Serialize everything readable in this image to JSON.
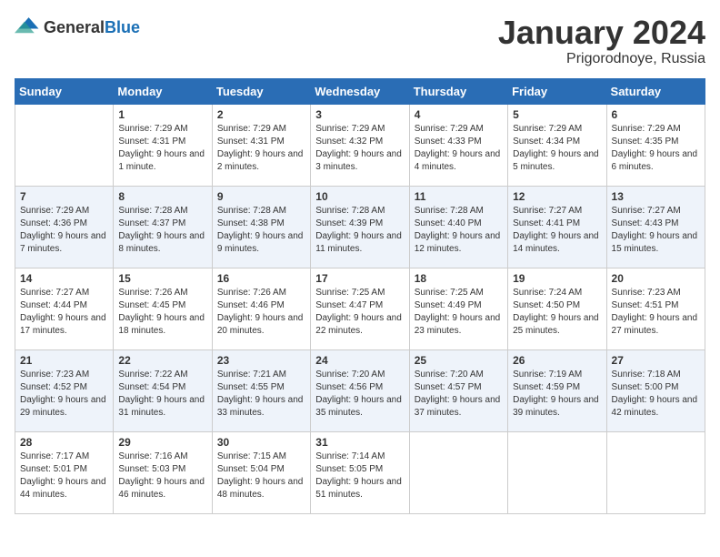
{
  "header": {
    "logo_general": "General",
    "logo_blue": "Blue",
    "title": "January 2024",
    "location": "Prigorodnoye, Russia"
  },
  "days_of_week": [
    "Sunday",
    "Monday",
    "Tuesday",
    "Wednesday",
    "Thursday",
    "Friday",
    "Saturday"
  ],
  "weeks": [
    [
      {
        "day": "",
        "sunrise": "",
        "sunset": "",
        "daylight": ""
      },
      {
        "day": "1",
        "sunrise": "7:29 AM",
        "sunset": "4:31 PM",
        "daylight": "9 hours and 1 minute."
      },
      {
        "day": "2",
        "sunrise": "7:29 AM",
        "sunset": "4:31 PM",
        "daylight": "9 hours and 2 minutes."
      },
      {
        "day": "3",
        "sunrise": "7:29 AM",
        "sunset": "4:32 PM",
        "daylight": "9 hours and 3 minutes."
      },
      {
        "day": "4",
        "sunrise": "7:29 AM",
        "sunset": "4:33 PM",
        "daylight": "9 hours and 4 minutes."
      },
      {
        "day": "5",
        "sunrise": "7:29 AM",
        "sunset": "4:34 PM",
        "daylight": "9 hours and 5 minutes."
      },
      {
        "day": "6",
        "sunrise": "7:29 AM",
        "sunset": "4:35 PM",
        "daylight": "9 hours and 6 minutes."
      }
    ],
    [
      {
        "day": "7",
        "sunrise": "7:29 AM",
        "sunset": "4:36 PM",
        "daylight": "9 hours and 7 minutes."
      },
      {
        "day": "8",
        "sunrise": "7:28 AM",
        "sunset": "4:37 PM",
        "daylight": "9 hours and 8 minutes."
      },
      {
        "day": "9",
        "sunrise": "7:28 AM",
        "sunset": "4:38 PM",
        "daylight": "9 hours and 9 minutes."
      },
      {
        "day": "10",
        "sunrise": "7:28 AM",
        "sunset": "4:39 PM",
        "daylight": "9 hours and 11 minutes."
      },
      {
        "day": "11",
        "sunrise": "7:28 AM",
        "sunset": "4:40 PM",
        "daylight": "9 hours and 12 minutes."
      },
      {
        "day": "12",
        "sunrise": "7:27 AM",
        "sunset": "4:41 PM",
        "daylight": "9 hours and 14 minutes."
      },
      {
        "day": "13",
        "sunrise": "7:27 AM",
        "sunset": "4:43 PM",
        "daylight": "9 hours and 15 minutes."
      }
    ],
    [
      {
        "day": "14",
        "sunrise": "7:27 AM",
        "sunset": "4:44 PM",
        "daylight": "9 hours and 17 minutes."
      },
      {
        "day": "15",
        "sunrise": "7:26 AM",
        "sunset": "4:45 PM",
        "daylight": "9 hours and 18 minutes."
      },
      {
        "day": "16",
        "sunrise": "7:26 AM",
        "sunset": "4:46 PM",
        "daylight": "9 hours and 20 minutes."
      },
      {
        "day": "17",
        "sunrise": "7:25 AM",
        "sunset": "4:47 PM",
        "daylight": "9 hours and 22 minutes."
      },
      {
        "day": "18",
        "sunrise": "7:25 AM",
        "sunset": "4:49 PM",
        "daylight": "9 hours and 23 minutes."
      },
      {
        "day": "19",
        "sunrise": "7:24 AM",
        "sunset": "4:50 PM",
        "daylight": "9 hours and 25 minutes."
      },
      {
        "day": "20",
        "sunrise": "7:23 AM",
        "sunset": "4:51 PM",
        "daylight": "9 hours and 27 minutes."
      }
    ],
    [
      {
        "day": "21",
        "sunrise": "7:23 AM",
        "sunset": "4:52 PM",
        "daylight": "9 hours and 29 minutes."
      },
      {
        "day": "22",
        "sunrise": "7:22 AM",
        "sunset": "4:54 PM",
        "daylight": "9 hours and 31 minutes."
      },
      {
        "day": "23",
        "sunrise": "7:21 AM",
        "sunset": "4:55 PM",
        "daylight": "9 hours and 33 minutes."
      },
      {
        "day": "24",
        "sunrise": "7:20 AM",
        "sunset": "4:56 PM",
        "daylight": "9 hours and 35 minutes."
      },
      {
        "day": "25",
        "sunrise": "7:20 AM",
        "sunset": "4:57 PM",
        "daylight": "9 hours and 37 minutes."
      },
      {
        "day": "26",
        "sunrise": "7:19 AM",
        "sunset": "4:59 PM",
        "daylight": "9 hours and 39 minutes."
      },
      {
        "day": "27",
        "sunrise": "7:18 AM",
        "sunset": "5:00 PM",
        "daylight": "9 hours and 42 minutes."
      }
    ],
    [
      {
        "day": "28",
        "sunrise": "7:17 AM",
        "sunset": "5:01 PM",
        "daylight": "9 hours and 44 minutes."
      },
      {
        "day": "29",
        "sunrise": "7:16 AM",
        "sunset": "5:03 PM",
        "daylight": "9 hours and 46 minutes."
      },
      {
        "day": "30",
        "sunrise": "7:15 AM",
        "sunset": "5:04 PM",
        "daylight": "9 hours and 48 minutes."
      },
      {
        "day": "31",
        "sunrise": "7:14 AM",
        "sunset": "5:05 PM",
        "daylight": "9 hours and 51 minutes."
      },
      {
        "day": "",
        "sunrise": "",
        "sunset": "",
        "daylight": ""
      },
      {
        "day": "",
        "sunrise": "",
        "sunset": "",
        "daylight": ""
      },
      {
        "day": "",
        "sunrise": "",
        "sunset": "",
        "daylight": ""
      }
    ]
  ],
  "labels": {
    "sunrise": "Sunrise:",
    "sunset": "Sunset:",
    "daylight": "Daylight:"
  }
}
